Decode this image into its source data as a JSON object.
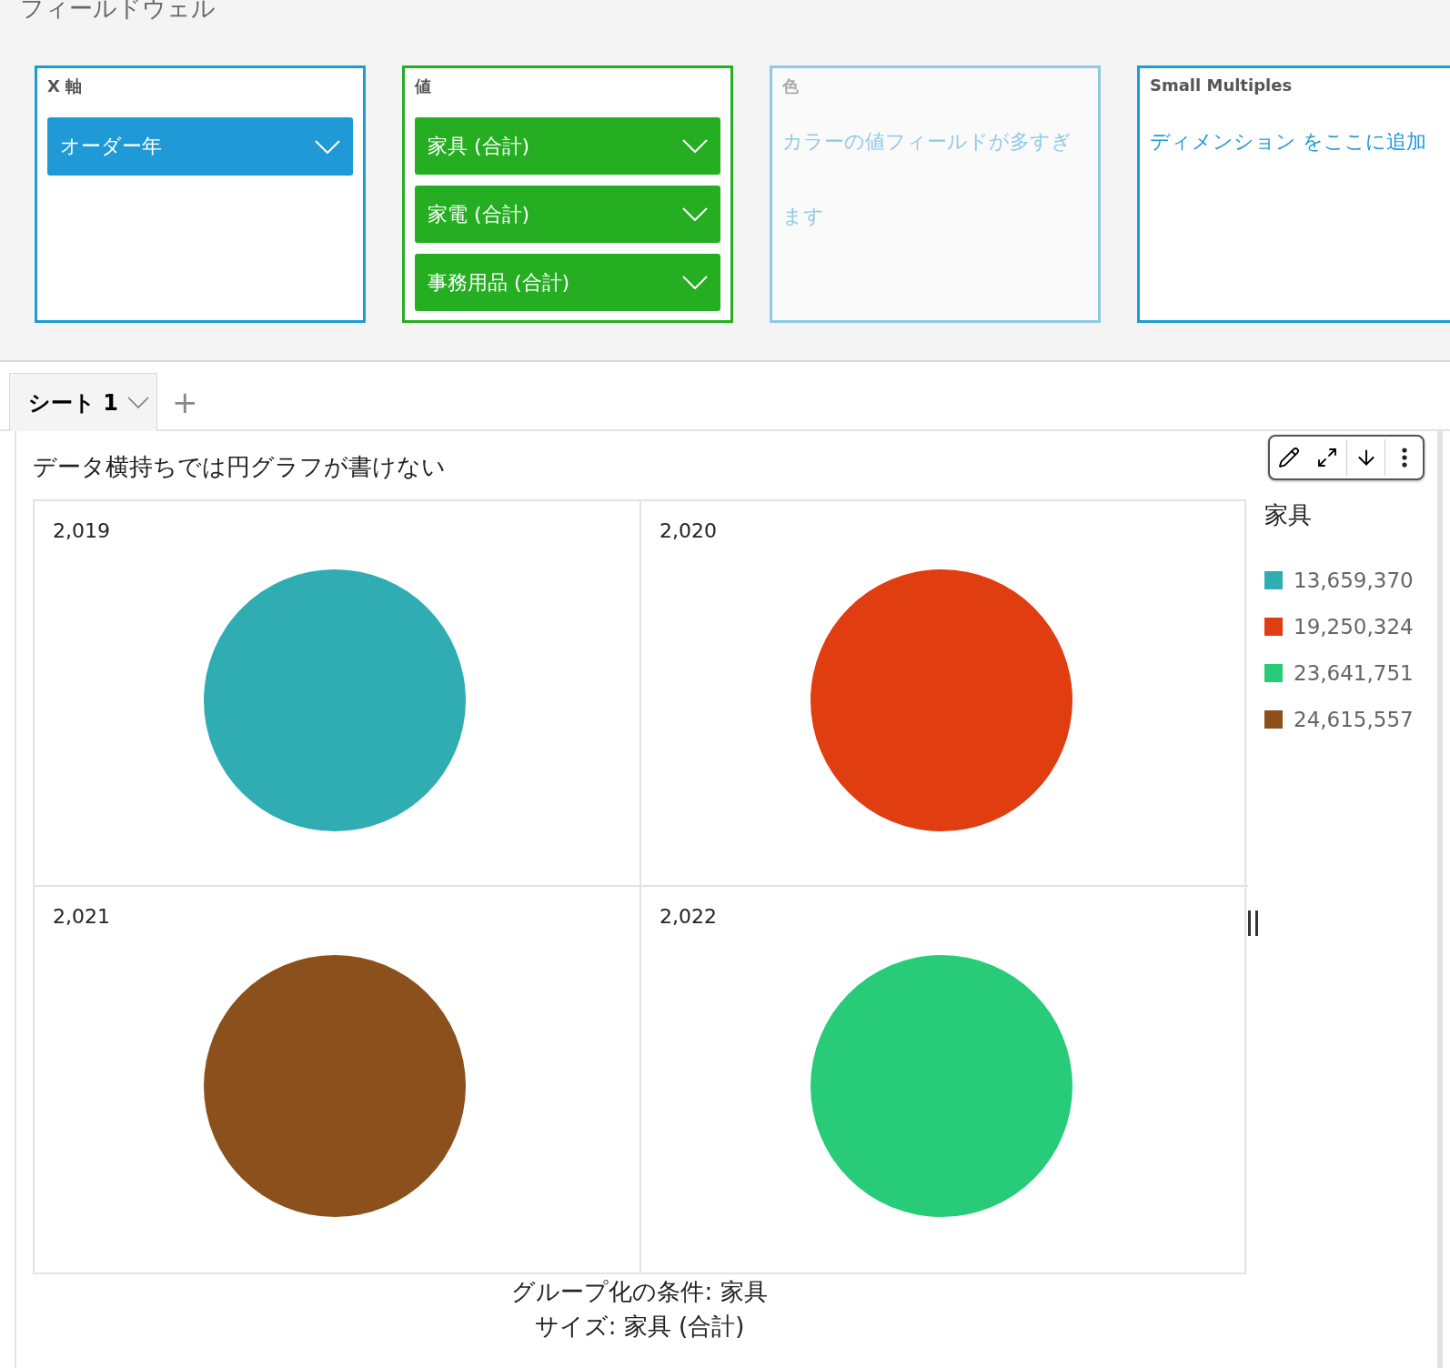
{
  "field_wells": {
    "title": "フィールドウェル",
    "wells": [
      {
        "label": "X 軸",
        "kind": "fields",
        "color": "#1f9ad6",
        "disabled": false,
        "fields": [
          "オーダー年"
        ]
      },
      {
        "label": "値",
        "kind": "fields",
        "color": "#26ae22",
        "disabled": false,
        "fields": [
          "家具 (合計)",
          "家電 (合計)",
          "事務用品 (合計)"
        ]
      },
      {
        "label": "色",
        "kind": "message",
        "color": "#8ecae6",
        "disabled": true,
        "message": "カラーの値フィールドが多すぎます"
      },
      {
        "label": "Small Multiples",
        "kind": "message",
        "color": "#1f9ad6",
        "disabled": false,
        "message": "ディメンション をここに追加"
      }
    ]
  },
  "sheet_tabs": {
    "tabs": [
      {
        "label": "シート 1",
        "selected": true
      }
    ],
    "add": "+"
  },
  "visual": {
    "title": "データ横持ちでは円グラフが書けない",
    "panels": [
      {
        "label": "2,019",
        "color": "#30adb3"
      },
      {
        "label": "2,020",
        "color": "#e03d10"
      },
      {
        "label": "2,021",
        "color": "#8b501b"
      },
      {
        "label": "2,022",
        "color": "#28cc78"
      }
    ],
    "legend": {
      "title": "家具",
      "items": [
        {
          "label": "13,659,370",
          "color": "#30adb3"
        },
        {
          "label": "19,250,324",
          "color": "#e03d10"
        },
        {
          "label": "23,641,751",
          "color": "#28cc78"
        },
        {
          "label": "24,615,557",
          "color": "#8b501b"
        }
      ]
    },
    "captions": [
      "グループ化の条件: 家具",
      "サイズ: 家具 (合計)"
    ]
  }
}
